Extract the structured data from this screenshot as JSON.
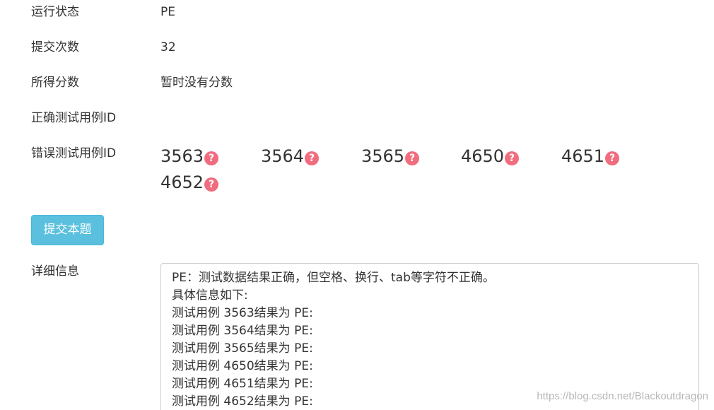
{
  "fields": {
    "status_label": "运行状态",
    "status_value": "PE",
    "submit_count_label": "提交次数",
    "submit_count_value": "32",
    "score_label": "所得分数",
    "score_value": "暂时没有分数",
    "correct_cases_label": "正确测试用例ID",
    "wrong_cases_label": "错误测试用例ID"
  },
  "wrong_cases": [
    "3563",
    "3564",
    "3565",
    "4650",
    "4651",
    "4652"
  ],
  "help_icon": "question-circle-icon",
  "submit_button_label": "提交本题",
  "detail": {
    "label": "详细信息",
    "lines": [
      "PE：测试数据结果正确，但空格、换行、tab等字符不正确。",
      "具体信息如下:",
      "测试用例 3563结果为 PE:",
      "测试用例 3564结果为 PE:",
      "测试用例 3565结果为 PE:",
      "测试用例 4650结果为 PE:",
      "测试用例 4651结果为 PE:",
      "测试用例 4652结果为 PE:"
    ]
  },
  "watermark": "https://blog.csdn.net/Blackoutdragon",
  "colors": {
    "button_bg": "#5bc0de",
    "icon_bg": "#f06d7f",
    "text": "#333333"
  }
}
